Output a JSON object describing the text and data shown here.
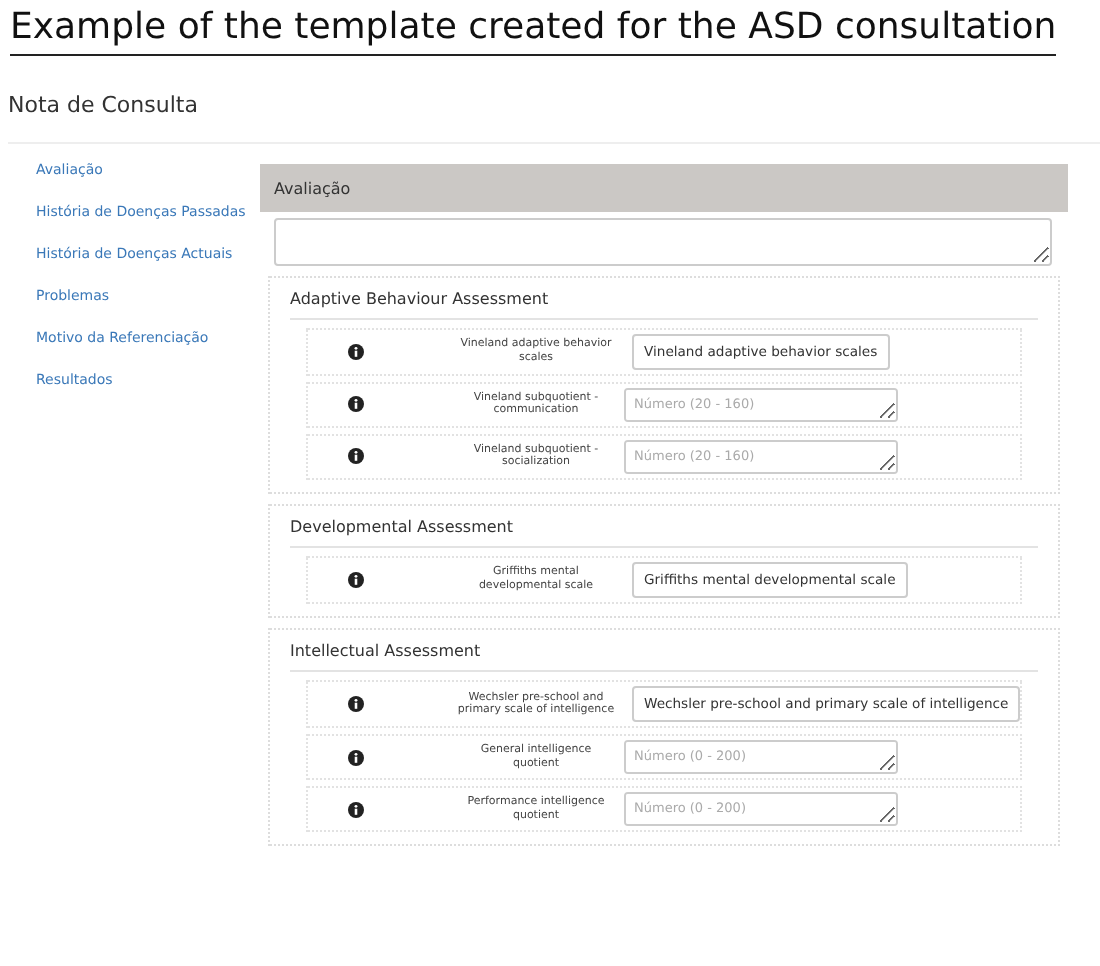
{
  "caption": "Example of the template created for the ASD consultation",
  "page_title": "Nota de Consulta",
  "sidebar": {
    "items": [
      {
        "label": "Avaliação"
      },
      {
        "label": "História de Doenças Passadas"
      },
      {
        "label": "História de Doenças Actuais"
      },
      {
        "label": "Problemas"
      },
      {
        "label": "Motivo da Referenciação"
      },
      {
        "label": "Resultados"
      }
    ]
  },
  "panel": {
    "title": "Avaliação",
    "sections": [
      {
        "title": "Adaptive Behaviour Assessment",
        "fields": [
          {
            "kind": "button",
            "label": "Vineland adaptive behavior scales",
            "text": "Vineland adaptive behavior scales"
          },
          {
            "kind": "number",
            "label": "Vineland subquotient - communication",
            "placeholder": "Número (20 - 160)"
          },
          {
            "kind": "number",
            "label": "Vineland subquotient - socialization",
            "placeholder": "Número (20 - 160)"
          }
        ]
      },
      {
        "title": "Developmental Assessment",
        "fields": [
          {
            "kind": "button",
            "label": "Griffiths mental developmental scale",
            "text": "Griffiths mental developmental scale"
          }
        ]
      },
      {
        "title": "Intellectual Assessment",
        "fields": [
          {
            "kind": "button",
            "label": "Wechsler pre-school and primary scale of intelligence",
            "text": "Wechsler pre-school and primary scale of intelligence"
          },
          {
            "kind": "number",
            "label": "General intelligence quotient",
            "placeholder": "Número (0 - 200)"
          },
          {
            "kind": "number",
            "label": "Performance intelligence quotient",
            "placeholder": "Número (0 - 200)"
          }
        ]
      }
    ]
  }
}
